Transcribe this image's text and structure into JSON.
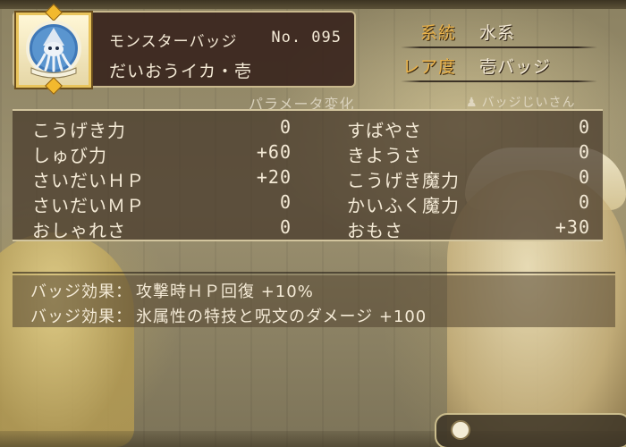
{
  "header": {
    "title": "モンスターバッジ",
    "number": "No. 095",
    "name": "だいおうイカ・壱",
    "badge_icon": "giant-squid-badge-icon"
  },
  "info": {
    "system_label": "系統",
    "system_value": "水系",
    "rarity_label": "レア度",
    "rarity_value": "壱バッジ"
  },
  "section": {
    "title": "パラメータ変化",
    "npc_name": "バッジじいさん",
    "npc_icon": "person-icon"
  },
  "params": {
    "left": [
      {
        "name": "こうげき力",
        "value": "0"
      },
      {
        "name": "しゅび力",
        "value": "+60"
      },
      {
        "name": "さいだいＨＰ",
        "value": "+20"
      },
      {
        "name": "さいだいＭＰ",
        "value": "0"
      },
      {
        "name": "おしゃれさ",
        "value": "0"
      }
    ],
    "right": [
      {
        "name": "すばやさ",
        "value": "0"
      },
      {
        "name": "きようさ",
        "value": "0"
      },
      {
        "name": "こうげき魔力",
        "value": "0"
      },
      {
        "name": "かいふく魔力",
        "value": "0"
      },
      {
        "name": "おもさ",
        "value": "+30"
      }
    ]
  },
  "effects": [
    {
      "label": "バッジ効果：",
      "text": "攻撃時ＨＰ回復 +10%"
    },
    {
      "label": "バッジ効果：",
      "text": "氷属性の特技と呪文のダメージ +100"
    }
  ],
  "colors": {
    "accent_gold": "#e9b24a",
    "text_light": "#f4ead6",
    "panel_dark": "#3a261e"
  }
}
